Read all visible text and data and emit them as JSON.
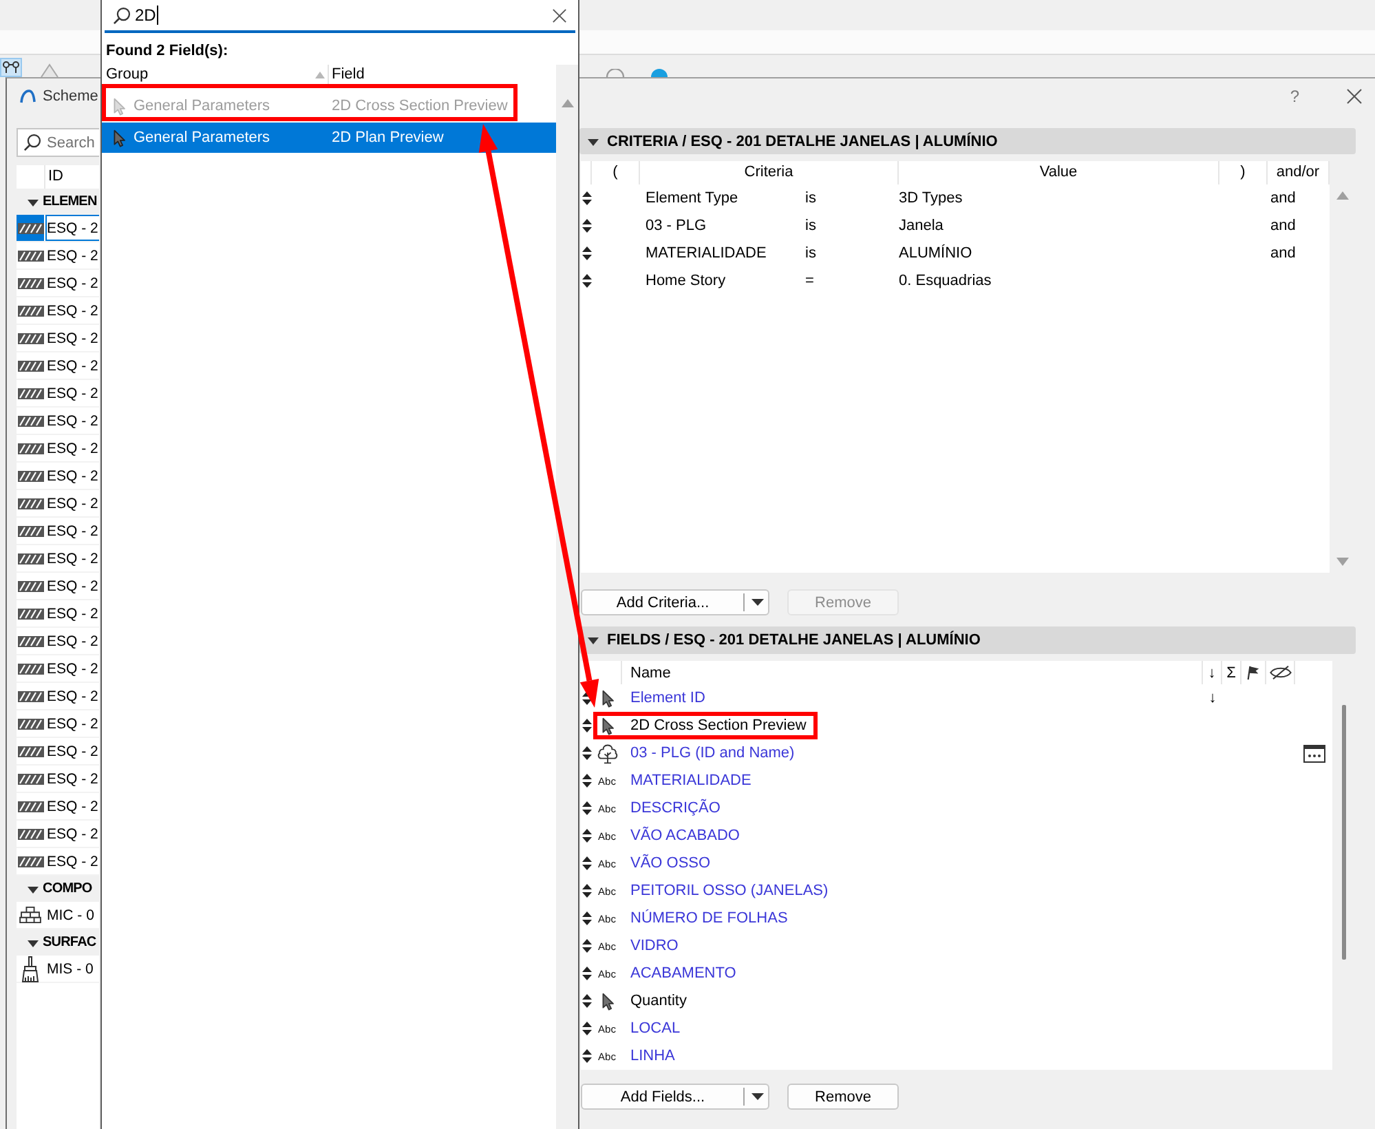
{
  "toolbar": {
    "tools": [
      {
        "kind": "nodes",
        "selected": true
      },
      {
        "kind": "diamond",
        "selected": false
      }
    ],
    "tools_behind_dialog": [
      {
        "kind": "ring"
      },
      {
        "kind": "disc"
      }
    ]
  },
  "dialog": {
    "title": "Scheme",
    "help": "?"
  },
  "element_list": {
    "search": {
      "placeholder": "Search"
    },
    "column": "ID",
    "groups": [
      {
        "label": "ELEMEN",
        "kind": "element",
        "expanded": true,
        "items": [
          {
            "id": "ESQ - 2",
            "selected": true
          },
          {
            "id": "ESQ - 2",
            "selected": false
          },
          {
            "id": "ESQ - 2",
            "selected": false
          },
          {
            "id": "ESQ - 2",
            "selected": false
          },
          {
            "id": "ESQ - 2",
            "selected": false
          },
          {
            "id": "ESQ - 2",
            "selected": false
          },
          {
            "id": "ESQ - 2",
            "selected": false
          },
          {
            "id": "ESQ - 2",
            "selected": false
          },
          {
            "id": "ESQ - 2",
            "selected": false
          },
          {
            "id": "ESQ - 2",
            "selected": false
          },
          {
            "id": "ESQ - 2",
            "selected": false
          },
          {
            "id": "ESQ - 2",
            "selected": false
          },
          {
            "id": "ESQ - 2",
            "selected": false
          },
          {
            "id": "ESQ - 2",
            "selected": false
          },
          {
            "id": "ESQ - 2",
            "selected": false
          },
          {
            "id": "ESQ - 2",
            "selected": false
          },
          {
            "id": "ESQ - 2",
            "selected": false
          },
          {
            "id": "ESQ - 2",
            "selected": false
          },
          {
            "id": "ESQ - 2",
            "selected": false
          },
          {
            "id": "ESQ - 2",
            "selected": false
          },
          {
            "id": "ESQ - 2",
            "selected": false
          },
          {
            "id": "ESQ - 2",
            "selected": false
          },
          {
            "id": "ESQ - 2",
            "selected": false
          },
          {
            "id": "ESQ - 2",
            "selected": false
          }
        ]
      },
      {
        "label": "COMPO",
        "kind": "composite",
        "expanded": true,
        "items": [
          {
            "id": "MIC - 0",
            "selected": false
          }
        ]
      },
      {
        "label": "SURFAC",
        "kind": "surface",
        "expanded": true,
        "items": [
          {
            "id": "MIS - 0",
            "selected": false
          }
        ]
      }
    ]
  },
  "field_search": {
    "query": "2D",
    "summary": "Found 2 Field(s):",
    "columns": [
      {
        "label": "Group",
        "sorted": true
      },
      {
        "label": "Field",
        "sorted": false
      }
    ],
    "results": [
      {
        "group": "General Parameters",
        "field": "2D Cross Section Preview",
        "selected": false,
        "disabled": true,
        "highlighted": true
      },
      {
        "group": "General Parameters",
        "field": "2D Plan Preview",
        "selected": true,
        "disabled": false,
        "highlighted": false
      }
    ]
  },
  "criteria": {
    "title": "CRITERIA / ESQ - 201 DETALHE JANELAS | ALUMÍNIO",
    "expanded": true,
    "columns": [
      "(",
      "Criteria",
      "Value",
      ")",
      "and/or"
    ],
    "rows": [
      {
        "criteria": "Element Type",
        "operator": "is",
        "value": "3D Types",
        "and_or": "and"
      },
      {
        "criteria": "03 - PLG",
        "operator": "is",
        "value": "Janela",
        "and_or": "and"
      },
      {
        "criteria": "MATERIALIDADE",
        "operator": "is",
        "value": "ALUMÍNIO",
        "and_or": "and"
      },
      {
        "criteria": "Home Story",
        "operator": "=",
        "value": "0. Esquadrias"
      }
    ],
    "buttons": [
      {
        "label": "Add Criteria...",
        "kind": "split",
        "disabled": false
      },
      {
        "label": "Remove",
        "kind": "plain",
        "disabled": true
      }
    ]
  },
  "fields": {
    "title": "FIELDS / ESQ - 201 DETALHE JANELAS | ALUMÍNIO",
    "expanded": true,
    "header": {
      "name": "Name",
      "sort": "↓",
      "sum": "Σ"
    },
    "rows": [
      {
        "kind": "pointer",
        "name": "Element ID",
        "color": "#3a36d8",
        "sort_order": "↓",
        "options_button": false,
        "highlighted": false
      },
      {
        "kind": "pointer",
        "name": "2D Cross Section Preview",
        "color": "#000000",
        "options_button": false,
        "highlighted": true
      },
      {
        "kind": "tree",
        "name": "03 - PLG (ID and Name)",
        "color": "#3a36d8",
        "options_button": true,
        "highlighted": false
      },
      {
        "kind": "text",
        "type_label": "Abc",
        "name": "MATERIALIDADE",
        "color": "#3a36d8",
        "options_button": false,
        "highlighted": false
      },
      {
        "kind": "text",
        "type_label": "Abc",
        "name": "DESCRIÇÃO",
        "color": "#3a36d8",
        "options_button": false,
        "highlighted": false
      },
      {
        "kind": "text",
        "type_label": "Abc",
        "name": "VÃO ACABADO",
        "color": "#3a36d8",
        "options_button": false,
        "highlighted": false
      },
      {
        "kind": "text",
        "type_label": "Abc",
        "name": "VÃO OSSO",
        "color": "#3a36d8",
        "options_button": false,
        "highlighted": false
      },
      {
        "kind": "text",
        "type_label": "Abc",
        "name": "PEITORIL OSSO (JANELAS)",
        "color": "#3a36d8",
        "options_button": false,
        "highlighted": false
      },
      {
        "kind": "text",
        "type_label": "Abc",
        "name": "NÚMERO DE FOLHAS",
        "color": "#3a36d8",
        "options_button": false,
        "highlighted": false
      },
      {
        "kind": "text",
        "type_label": "Abc",
        "name": "VIDRO",
        "color": "#3a36d8",
        "options_button": false,
        "highlighted": false
      },
      {
        "kind": "text",
        "type_label": "Abc",
        "name": "ACABAMENTO",
        "color": "#3a36d8",
        "options_button": false,
        "highlighted": false
      },
      {
        "kind": "pointer",
        "name": "Quantity",
        "color": "#000000",
        "options_button": false,
        "highlighted": false
      },
      {
        "kind": "text",
        "type_label": "Abc",
        "name": "LOCAL",
        "color": "#3a36d8",
        "options_button": false,
        "highlighted": false
      },
      {
        "kind": "text",
        "type_label": "Abc",
        "name": "LINHA",
        "color": "#3a36d8",
        "options_button": false,
        "highlighted": false
      }
    ],
    "buttons": [
      {
        "label": "Add Fields...",
        "kind": "split",
        "disabled": false
      },
      {
        "label": "Remove",
        "kind": "plain",
        "disabled": false
      }
    ]
  },
  "annotations": {
    "arrow_between_highlights": true
  }
}
